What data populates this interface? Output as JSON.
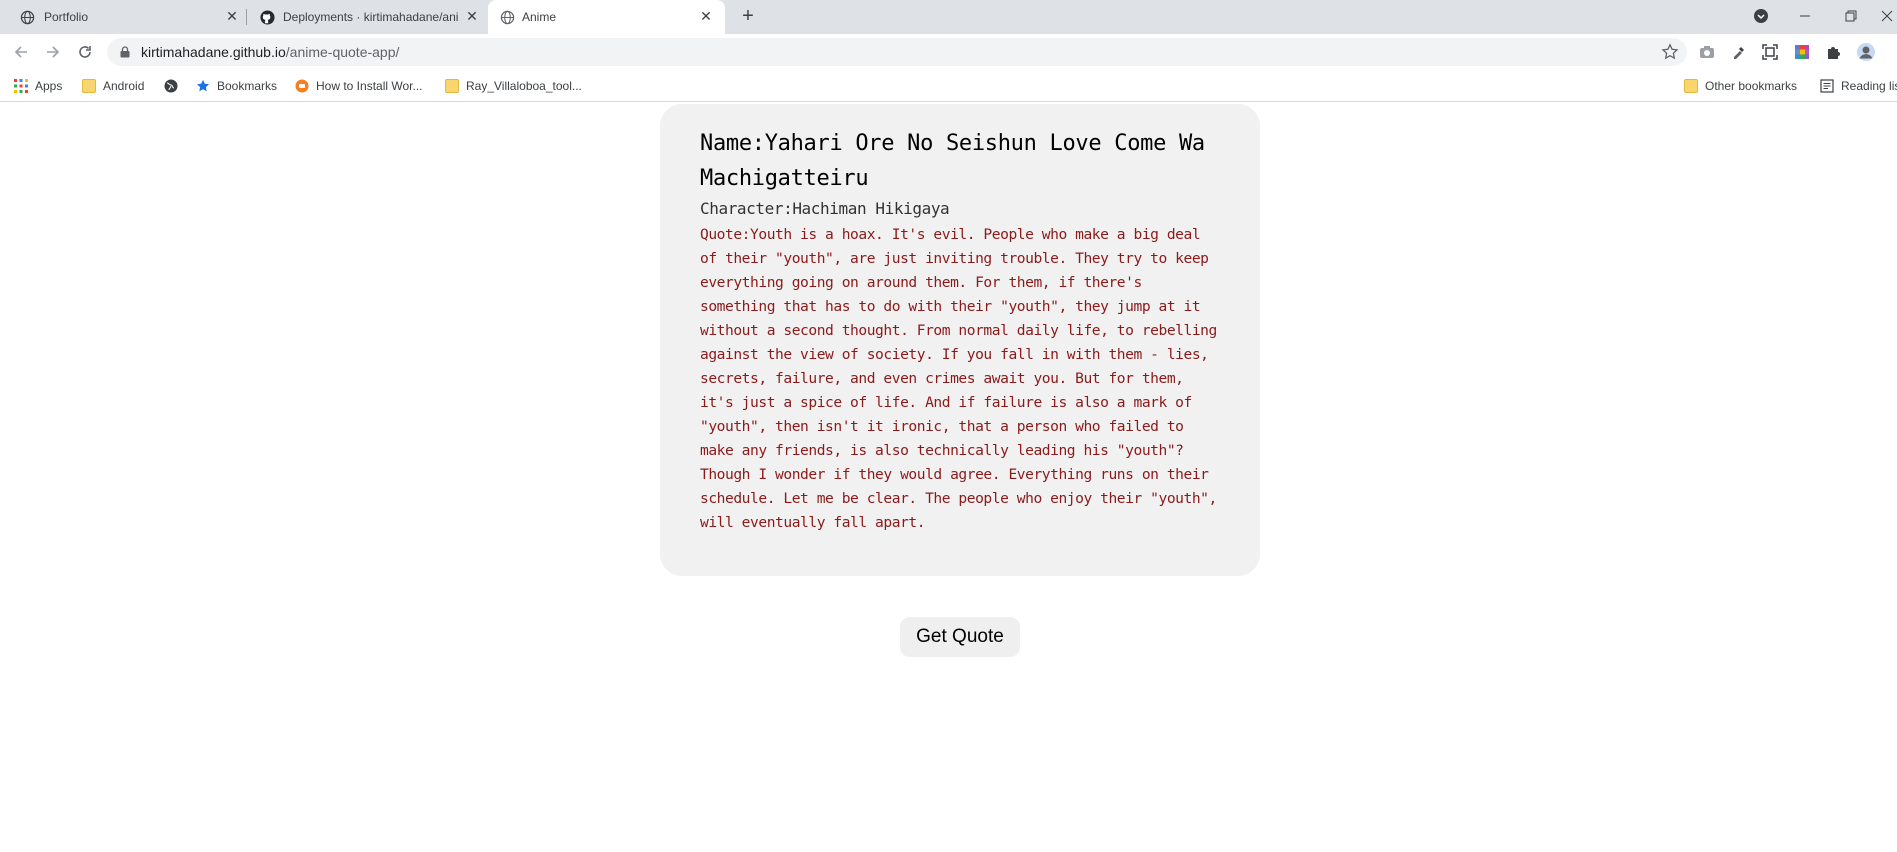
{
  "browser": {
    "tabs": [
      {
        "title": "Portfolio",
        "icon": "globe-icon"
      },
      {
        "title": "Deployments · kirtimahadane/anime-quote-app",
        "icon": "github-icon"
      },
      {
        "title": "Anime",
        "icon": "globe-icon",
        "active": true
      }
    ],
    "address": {
      "host": "kirtimahadane.github.io",
      "path": "/anime-quote-app/"
    },
    "bookmarks": [
      {
        "label": "Apps",
        "icon": "apps-grid-icon"
      },
      {
        "label": "Android",
        "icon": "folder-icon"
      },
      {
        "label": "",
        "icon": "globe-icon"
      },
      {
        "label": "Bookmarks",
        "icon": "star-icon"
      },
      {
        "label": "How to Install Wor...",
        "icon": "site-icon"
      },
      {
        "label": "Ray_Villaloboa_tool...",
        "icon": "folder-icon"
      }
    ],
    "bookmarks_right": [
      {
        "label": "Other bookmarks",
        "icon": "folder-icon"
      },
      {
        "label": "Reading list",
        "icon": "reading-list-icon"
      }
    ]
  },
  "quote_card": {
    "name": "Name:Yahari Ore No Seishun Love Come Wa Machigatteiru",
    "character": "Character:Hachiman Hikigaya",
    "quote": "Quote:Youth is a hoax. It's evil. People who make a big deal of their \"youth\", are just inviting trouble. They try to keep everything going on around them. For them, if there's something that has to do with their \"youth\", they jump at it without a second thought. From normal daily life, to rebelling against the view of society. If you fall in with them - lies, secrets, failure, and even crimes await you. But for them, it's just a spice of life. And if failure is also a mark of \"youth\", then isn't it ironic, that a person who failed to make any friends, is also technically leading his \"youth\"? Though I wonder if they would agree. Everything runs on their schedule. Let me be clear. The people who enjoy their \"youth\", will eventually fall apart."
  },
  "actions": {
    "get_quote_label": "Get Quote"
  },
  "colors": {
    "card_background": "#f1f1f1",
    "quote_text": "#8b1a1a",
    "button_background": "#efefef"
  }
}
